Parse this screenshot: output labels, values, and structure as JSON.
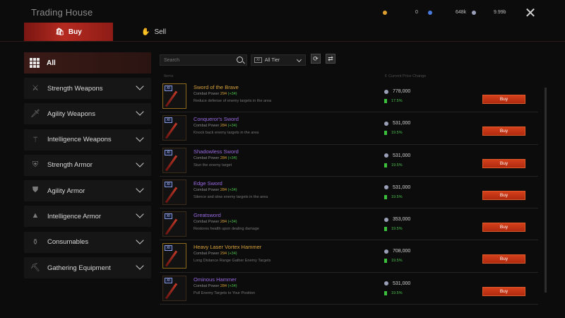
{
  "header": {
    "title": "Trading House",
    "currencies": [
      {
        "icon": "orange-gem-icon",
        "value": "0",
        "color": "#e0a030"
      },
      {
        "icon": "blue-gem-icon",
        "value": "648k",
        "color": "#4a7ae0"
      },
      {
        "icon": "silver-coin-icon",
        "value": "9.99b",
        "color": "#9aa0b8"
      }
    ]
  },
  "tabs": {
    "buy": "Buy",
    "sell": "Sell"
  },
  "sidebar": {
    "all_label": "All",
    "categories": [
      {
        "label": "Strength Weapons",
        "icon": "sword-icon"
      },
      {
        "label": "Agility Weapons",
        "icon": "dagger-icon"
      },
      {
        "label": "Intelligence Weapons",
        "icon": "staff-icon"
      },
      {
        "label": "Strength Armor",
        "icon": "heavy-armor-icon"
      },
      {
        "label": "Agility Armor",
        "icon": "light-armor-icon"
      },
      {
        "label": "Intelligence Armor",
        "icon": "robe-icon"
      },
      {
        "label": "Consumables",
        "icon": "potion-icon"
      },
      {
        "label": "Gathering Equipment",
        "icon": "pickaxe-icon"
      }
    ]
  },
  "toolbar": {
    "search_placeholder": "Search",
    "tier_label": "All Tier"
  },
  "columns": {
    "item": "Items",
    "price": "Current Price Change"
  },
  "items": [
    {
      "name": "Sword of the Brave",
      "name_color": "#d7a23a",
      "tier": "XI",
      "combat_label": "Combat Power",
      "combat": "294",
      "bonus": "(+34)",
      "desc": "Reduce defense of enemy targets in the area",
      "price": "778,000",
      "change": "17.5%",
      "buy": "Buy",
      "gold": true
    },
    {
      "name": "Conqueror's Sword",
      "name_color": "#9a6ae0",
      "tier": "XI",
      "combat_label": "Combat Power",
      "combat": "284",
      "bonus": "(+34)",
      "desc": "Knock back enemy targets in the area",
      "price": "531,000",
      "change": "19.5%",
      "buy": "Buy",
      "gold": false
    },
    {
      "name": "Shadowless Sword",
      "name_color": "#9a6ae0",
      "tier": "XI",
      "combat_label": "Combat Power",
      "combat": "284",
      "bonus": "(+34)",
      "desc": "Stun the enemy target",
      "price": "531,000",
      "change": "19.5%",
      "buy": "Buy",
      "gold": false
    },
    {
      "name": "Edge Sword",
      "name_color": "#9a6ae0",
      "tier": "XI",
      "combat_label": "Combat Power",
      "combat": "284",
      "bonus": "(+34)",
      "desc": "Silence and slow enemy targets in the area",
      "price": "531,000",
      "change": "19.5%",
      "buy": "Buy",
      "gold": false
    },
    {
      "name": "Greatsword",
      "name_color": "#9a6ae0",
      "tier": "XI",
      "combat_label": "Combat Power",
      "combat": "284",
      "bonus": "(+34)",
      "desc": "Restores health upon dealing damage",
      "price": "353,000",
      "change": "19.5%",
      "buy": "Buy",
      "gold": false
    },
    {
      "name": "Heavy Laser Vortex Hammer",
      "name_color": "#d7a23a",
      "tier": "XI",
      "combat_label": "Combat Power",
      "combat": "294",
      "bonus": "(+34)",
      "desc": "Long Distance Range Gather Enemy Targets",
      "price": "708,000",
      "change": "19.5%",
      "buy": "Buy",
      "gold": true
    },
    {
      "name": "Ominous Hammer",
      "name_color": "#9a6ae0",
      "tier": "XI",
      "combat_label": "Combat Power",
      "combat": "284",
      "bonus": "(+34)",
      "desc": "Pull Enemy Targets to Your Position",
      "price": "531,000",
      "change": "19.5%",
      "buy": "Buy",
      "gold": false
    }
  ]
}
